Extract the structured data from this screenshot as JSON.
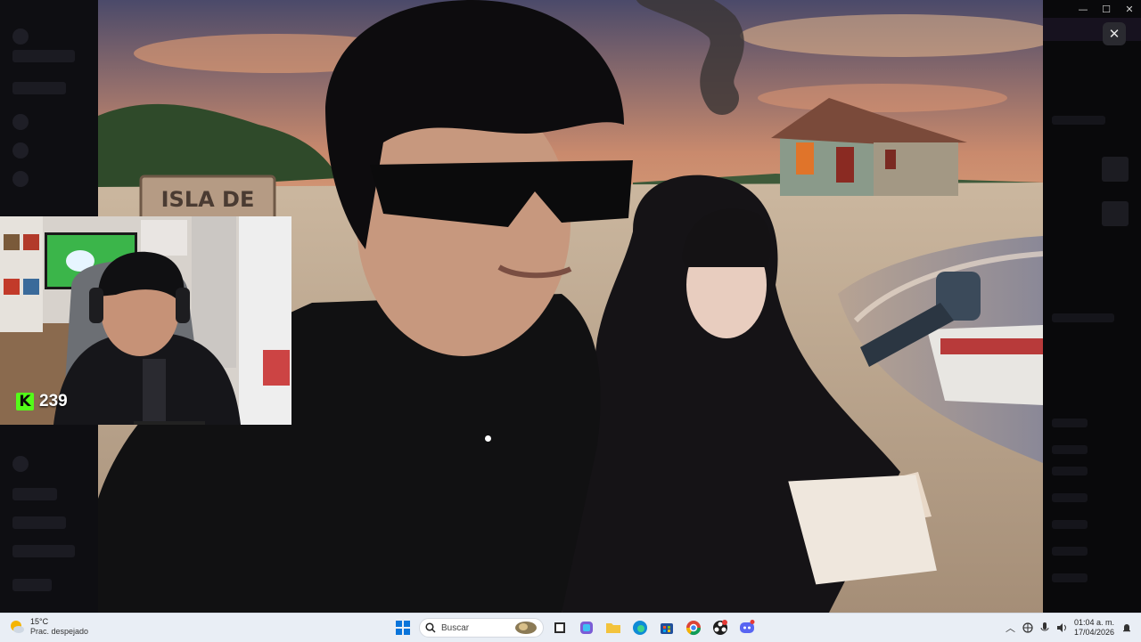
{
  "stream": {
    "viewer_count": "239",
    "platform_logo": "K"
  },
  "scene": {
    "sign_text_line1": "ISLA DE"
  },
  "window": {
    "close_overlay_glyph": "✕",
    "minimize_glyph": "—",
    "maximize_glyph": "☐",
    "close_glyph": "✕"
  },
  "taskbar": {
    "weather": {
      "temperature": "15°C",
      "condition": "Prac. despejado",
      "icon": "weather-partly-sunny-icon"
    },
    "search": {
      "placeholder": "Buscar"
    },
    "pinned_apps": [
      "windows-start-icon",
      "file-explorer-icon",
      "copilot-icon",
      "folder-icon",
      "edge-icon",
      "store-icon",
      "chrome-icon",
      "obs-icon",
      "discord-icon"
    ],
    "tray": {
      "time": "01:04 a. m.",
      "date": "17/04/2026"
    }
  },
  "colors": {
    "kick_green": "#53fc18",
    "taskbar_bg": "#e9eef5"
  }
}
